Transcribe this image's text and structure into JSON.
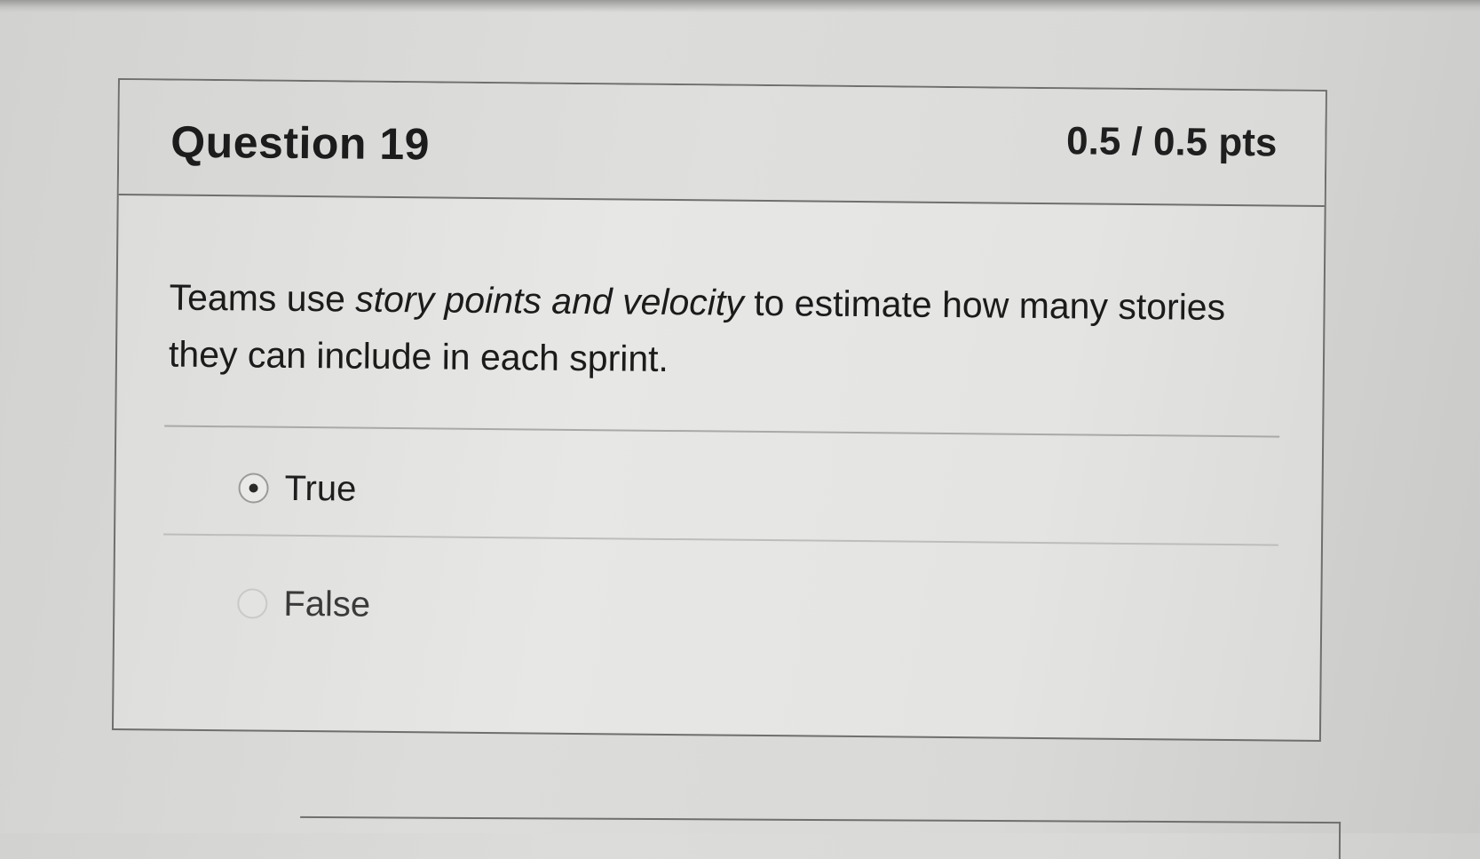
{
  "question": {
    "title": "Question 19",
    "points": "0.5 / 0.5 pts",
    "text_parts": {
      "before": "Teams use ",
      "emphasis": "story points and velocity",
      "after": " to estimate how many stories they can include in each sprint."
    }
  },
  "answers": [
    {
      "label": "True",
      "selected": true
    },
    {
      "label": "False",
      "selected": false
    }
  ],
  "colors": {
    "border": "#6f6f6d",
    "text": "#1c1c1c",
    "background": "#e2e2e0"
  }
}
